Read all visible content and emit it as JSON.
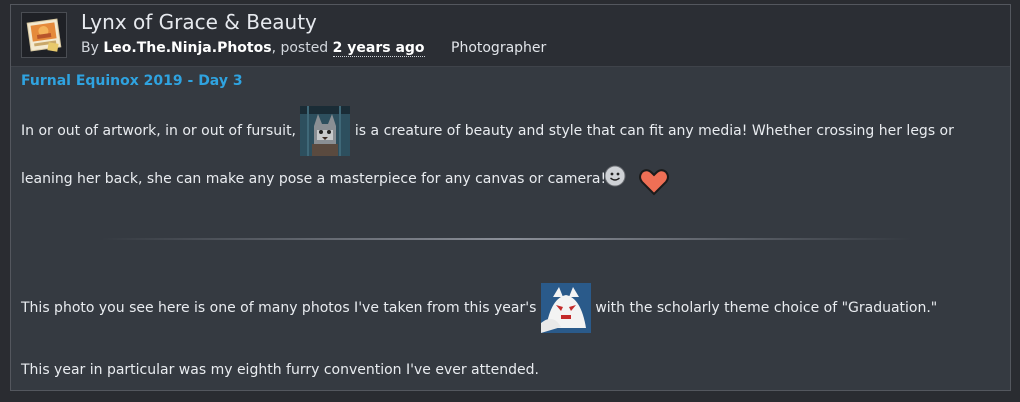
{
  "submission": {
    "title": "Lynx of Grace & Beauty",
    "by_label": "By",
    "author": "Leo.The.Ninja.Photos",
    "posted_label": ", posted",
    "posted_ago": "2 years ago",
    "category": "Photographer",
    "avatar_icon": "photo-avatar-icon"
  },
  "description": {
    "heading": "Furnal Equinox 2019 - Day 3",
    "para1_before": "In or out of artwork, in or out of fursuit,",
    "para1_after": "is a creature of beauty and style that can fit any media! Whether crossing her legs or",
    "para2": "leaning her back, she can make any pose a masterpiece for any canvas or camera!",
    "para3_before": "This photo you see here is one of many photos I've taken from this year's",
    "para3_after": "with the scholarly theme choice of \"Graduation.\"",
    "para4": "This year in particular was my eighth furry convention I've ever attended.",
    "icons": [
      "lynx-user-icon",
      "convention-icon",
      "smiley-emoji",
      "heart-emoji"
    ]
  },
  "colors": {
    "background": "#2a2c31",
    "panel": "#353a41",
    "header": "#2b2e34",
    "heading_blue": "#2fa3e0",
    "heart": "#ef6f55"
  }
}
